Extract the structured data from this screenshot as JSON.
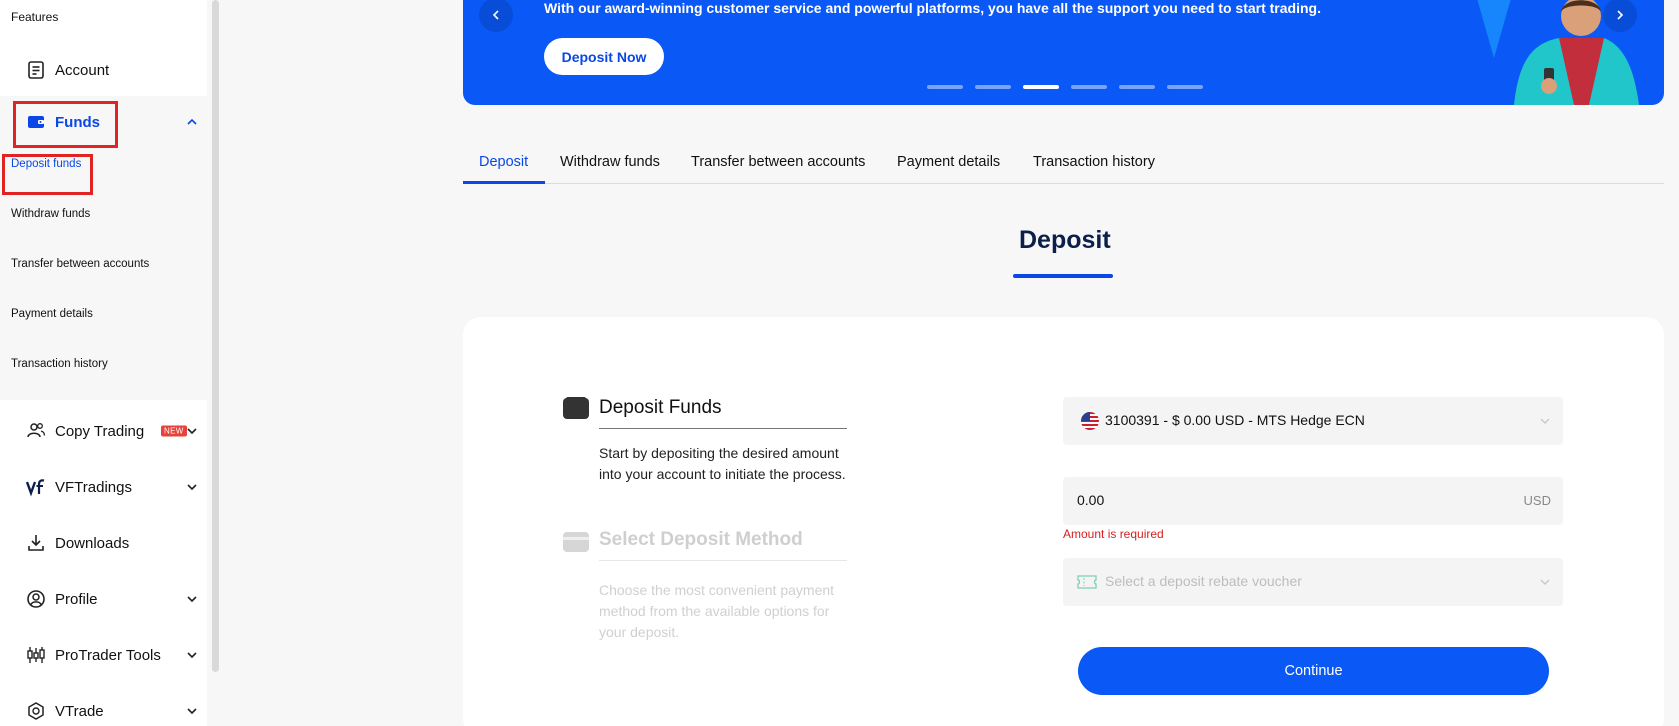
{
  "sidebar": {
    "header": "Features",
    "account_label": "Account",
    "funds_label": "Funds",
    "sub_items": [
      "Deposit funds",
      "Withdraw funds",
      "Transfer between accounts",
      "Payment details",
      "Transaction history"
    ],
    "copy_trading_label": "Copy Trading",
    "new_badge": "NEW",
    "vftradings_label": "VFTradings",
    "downloads_label": "Downloads",
    "profile_label": "Profile",
    "protrader_label": "ProTrader Tools",
    "vtrade_label": "VTrade"
  },
  "banner": {
    "text": "With our award-winning customer service and powerful platforms, you have all the support you need to start trading.",
    "button_label": "Deposit Now",
    "dot_count": 6,
    "active_dot": 3
  },
  "tabs": [
    "Deposit",
    "Withdraw funds",
    "Transfer between accounts",
    "Payment details",
    "Transaction history"
  ],
  "section_title": "Deposit",
  "steps": {
    "step1_title": "Deposit Funds",
    "step1_desc_line1": "Start by depositing the desired amount",
    "step1_desc_line2": "into your account to initiate the process.",
    "step2_title": "Select Deposit Method",
    "step2_desc_line1": "Choose the most convenient payment",
    "step2_desc_line2": "method from the available options for",
    "step2_desc_line3": "your deposit."
  },
  "form": {
    "account_value": "3100391 - $ 0.00 USD - MTS Hedge ECN",
    "amount_value": "0.00",
    "amount_currency": "USD",
    "amount_error": "Amount is required",
    "voucher_placeholder": "Select a deposit rebate voucher",
    "continue_label": "Continue"
  },
  "colors": {
    "primary": "#0a58f5",
    "brand_blue": "#0a47e6",
    "error": "#d81e1e",
    "highlight_box": "#e02323"
  }
}
